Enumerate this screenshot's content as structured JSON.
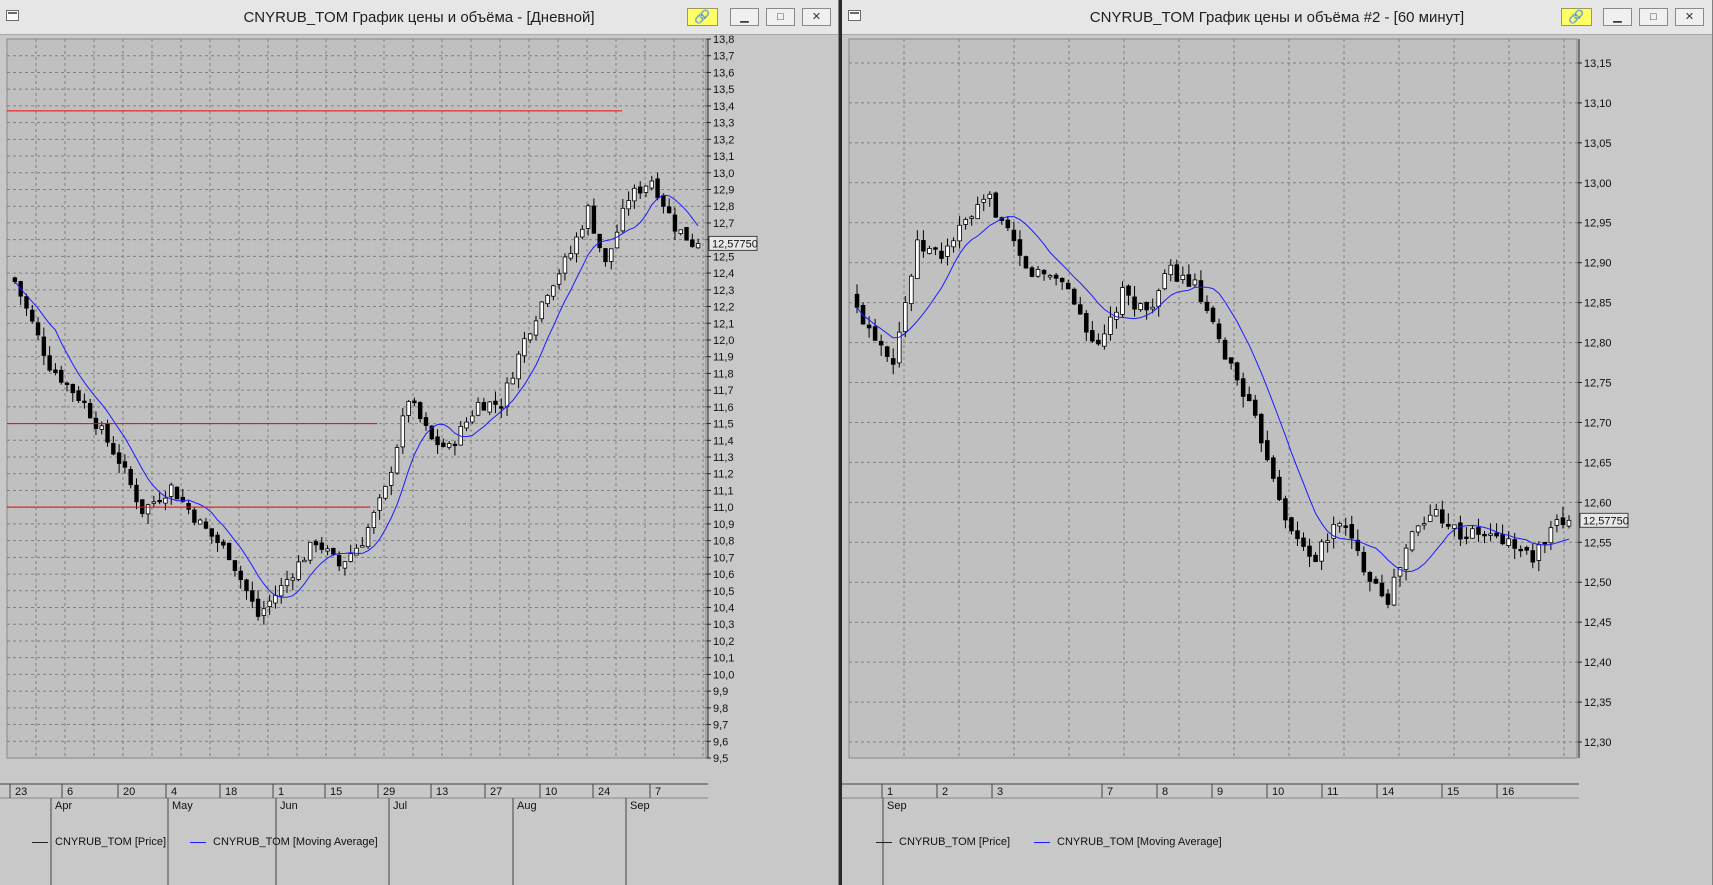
{
  "windows": [
    {
      "title": "CNYRUB_TOM График цены и объёма - [Дневной]",
      "link_icon": "link-icon",
      "buttons": [
        "minimize-icon",
        "maximize-icon",
        "close-icon"
      ],
      "legend": {
        "price": "CNYRUB_TOM [Price]",
        "ma": "CNYRUB_TOM [Moving Average]"
      },
      "current_price_label": "12,57750",
      "colors": {
        "background": "#c0c0c0",
        "up_candle": "#ffffff",
        "down_candle": "#000000",
        "moving_average": "#1c1cff",
        "level_line": "#ff0000",
        "grid": "#808080"
      }
    },
    {
      "title": "CNYRUB_TOM График цены и объёма #2 - [60 минут]",
      "link_icon": "link-icon",
      "buttons": [
        "minimize-icon",
        "maximize-icon",
        "close-icon"
      ],
      "legend": {
        "price": "CNYRUB_TOM [Price]",
        "ma": "CNYRUB_TOM [Moving Average]"
      },
      "current_price_label": "12,57750",
      "colors": {
        "background": "#c0c0c0",
        "up_candle": "#ffffff",
        "down_candle": "#000000",
        "moving_average": "#1c1cff",
        "grid": "#808080"
      }
    }
  ],
  "chart_data": [
    {
      "type": "candlestick",
      "symbol": "CNYRUB_TOM",
      "timeframe": "Дневной",
      "ylim": [
        9.5,
        13.8
      ],
      "y_ticks": [
        "13,8",
        "13,7",
        "13,6",
        "13,5",
        "13,4",
        "13,3",
        "13,2",
        "13,1",
        "13,0",
        "12,9",
        "12,8",
        "12,7",
        "12,6",
        "12,5",
        "12,4",
        "12,3",
        "12,2",
        "12,1",
        "12,0",
        "11,9",
        "11,8",
        "11,7",
        "11,6",
        "11,5",
        "11,4",
        "11,3",
        "11,2",
        "11,1",
        "11,0",
        "10,9",
        "10,8",
        "10,7",
        "10,6",
        "10,5",
        "10,4",
        "10,3",
        "10,2",
        "10,1",
        "10,0",
        "9,9",
        "9,8",
        "9,7",
        "9,6",
        "9,5"
      ],
      "x_day_labels": [
        "23",
        "6",
        "20",
        "4",
        "18",
        "1",
        "15",
        "29",
        "13",
        "27",
        "10",
        "24",
        "7"
      ],
      "x_month_labels": [
        "Apr",
        "May",
        "Jun",
        "Jul",
        "Aug",
        "Sep"
      ],
      "levels": [
        13.37,
        11.5,
        11.0
      ],
      "last_price": 12.5775,
      "grid": true,
      "legend_position": "bottom-left",
      "close_path": [
        [
          0,
          12.35
        ],
        [
          6,
          11.85
        ],
        [
          12,
          11.62
        ],
        [
          18,
          11.28
        ],
        [
          22,
          10.98
        ],
        [
          27,
          11.12
        ],
        [
          32,
          10.9
        ],
        [
          37,
          10.72
        ],
        [
          42,
          10.35
        ],
        [
          46,
          10.52
        ],
        [
          52,
          10.8
        ],
        [
          56,
          10.65
        ],
        [
          60,
          10.8
        ],
        [
          64,
          11.1
        ],
        [
          68,
          11.65
        ],
        [
          72,
          11.4
        ],
        [
          75,
          11.35
        ],
        [
          80,
          11.62
        ],
        [
          84,
          11.62
        ],
        [
          88,
          12.0
        ],
        [
          92,
          12.3
        ],
        [
          96,
          12.52
        ],
        [
          99,
          12.78
        ],
        [
          102,
          12.45
        ],
        [
          106,
          12.85
        ],
        [
          110,
          12.96
        ],
        [
          114,
          12.68
        ],
        [
          117,
          12.58
        ],
        [
          118,
          12.5775
        ]
      ]
    },
    {
      "type": "candlestick",
      "symbol": "CNYRUB_TOM",
      "timeframe": "60 минут",
      "ylim": [
        12.28,
        13.18
      ],
      "y_ticks": [
        "13,15",
        "13,10",
        "13,05",
        "13,00",
        "12,95",
        "12,90",
        "12,85",
        "12,80",
        "12,75",
        "12,70",
        "12,65",
        "12,60",
        "12,55",
        "12,50",
        "12,45",
        "12,40",
        "12,35",
        "12,30"
      ],
      "x_day_labels": [
        "1",
        "2",
        "3",
        "7",
        "8",
        "9",
        "10",
        "11",
        "14",
        "15",
        "16"
      ],
      "x_month_labels": [
        "Sep"
      ],
      "last_price": 12.5775,
      "grid": true,
      "legend_position": "bottom-left",
      "close_path": [
        [
          0,
          12.84
        ],
        [
          6,
          12.78
        ],
        [
          10,
          12.92
        ],
        [
          14,
          12.91
        ],
        [
          18,
          12.95
        ],
        [
          22,
          12.98
        ],
        [
          28,
          12.89
        ],
        [
          34,
          12.88
        ],
        [
          40,
          12.79
        ],
        [
          44,
          12.86
        ],
        [
          48,
          12.84
        ],
        [
          52,
          12.89
        ],
        [
          56,
          12.87
        ],
        [
          60,
          12.8
        ],
        [
          64,
          12.74
        ],
        [
          68,
          12.66
        ],
        [
          72,
          12.56
        ],
        [
          76,
          12.53
        ],
        [
          80,
          12.58
        ],
        [
          84,
          12.52
        ],
        [
          88,
          12.48
        ],
        [
          92,
          12.56
        ],
        [
          96,
          12.59
        ],
        [
          100,
          12.56
        ],
        [
          104,
          12.56
        ],
        [
          108,
          12.55
        ],
        [
          112,
          12.53
        ],
        [
          116,
          12.57
        ],
        [
          118,
          12.5775
        ]
      ]
    }
  ]
}
